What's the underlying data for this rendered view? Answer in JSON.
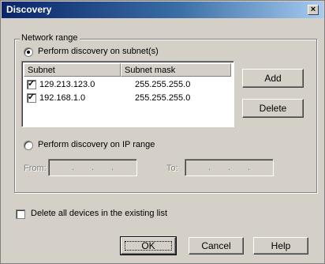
{
  "window": {
    "title": "Discovery",
    "close_glyph": "×"
  },
  "group": {
    "legend": "Network range",
    "radio_subnet_label": "Perform discovery on subnet(s)",
    "radio_ip_label": "Perform discovery on IP range",
    "selected": "subnet"
  },
  "subnet_list": {
    "columns": [
      "Subnet",
      "Subnet mask"
    ],
    "rows": [
      {
        "checked": true,
        "subnet": "129.213.123.0",
        "mask": "255.255.255.0"
      },
      {
        "checked": true,
        "subnet": "192.168.1.0",
        "mask": "255.255.255.0"
      }
    ]
  },
  "side_buttons": {
    "add": "Add",
    "delete": "Delete"
  },
  "ip_range": {
    "from_label": "From:",
    "to_label": "To:",
    "dots": ".",
    "enabled": false
  },
  "delete_all": {
    "label": "Delete all devices in the existing list",
    "checked": false
  },
  "footer_buttons": {
    "ok": "OK",
    "cancel": "Cancel",
    "help": "Help"
  }
}
